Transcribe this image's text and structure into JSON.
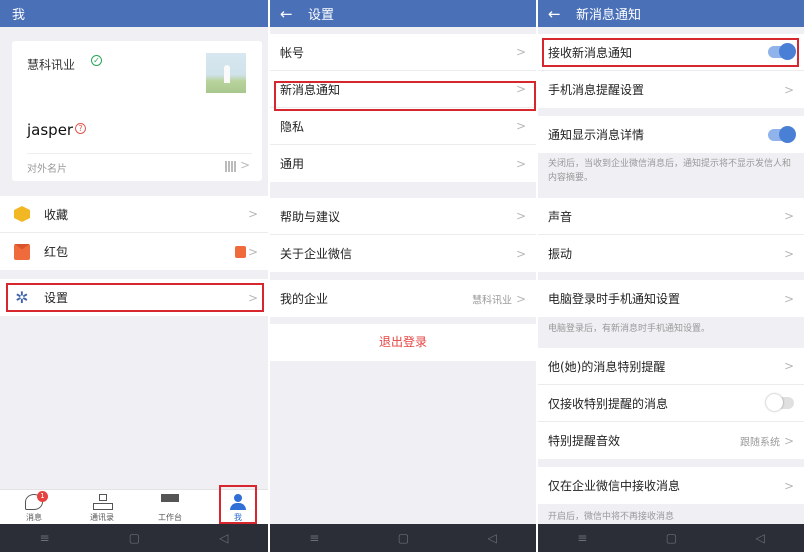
{
  "screen1": {
    "title": "我",
    "card": {
      "company": "慧科讯业",
      "verified_icon": "✓",
      "name": "jasper",
      "help_icon": "?",
      "namecard_label": "对外名片"
    },
    "menu": [
      {
        "label": "收藏",
        "icon": "cube-icon"
      },
      {
        "label": "红包",
        "icon": "red-envelope-icon"
      }
    ],
    "settings_label": "设置",
    "tabs": [
      {
        "label": "消息",
        "badge": "1"
      },
      {
        "label": "通讯录"
      },
      {
        "label": "工作台"
      },
      {
        "label": "我"
      }
    ]
  },
  "screen2": {
    "title": "设置",
    "group1": [
      "帐号",
      "新消息通知",
      "隐私",
      "通用"
    ],
    "group2": [
      "帮助与建议",
      "关于企业微信"
    ],
    "enterprise_label": "我的企业",
    "enterprise_value": "慧科讯业",
    "logout": "退出登录"
  },
  "screen3": {
    "title": "新消息通知",
    "receive_label": "接收新消息通知",
    "receive_on": true,
    "phone_reminder_label": "手机消息提醒设置",
    "show_detail_label": "通知显示消息详情",
    "show_detail_on": true,
    "show_detail_note": "关闭后，当收到企业微信消息后，通知提示将不显示发信人和内容摘要。",
    "sound_label": "声音",
    "vibrate_label": "振动",
    "pc_login_label": "电脑登录时手机通知设置",
    "pc_login_note": "电脑登录后，有新消息时手机通知设置。",
    "special_label": "他(她)的消息特别提醒",
    "only_special_label": "仅接收特别提醒的消息",
    "only_special_on": false,
    "special_sound_label": "特别提醒音效",
    "special_sound_value": "跟随系统",
    "only_wework_label": "仅在企业微信中接收消息",
    "only_wework_note": "开启后，微信中将不再接收消息"
  },
  "system_nav": {
    "menu": "≡",
    "home": "▢",
    "back": "◁"
  },
  "glyphs": {
    "back_arrow": "←",
    "chevron": ">",
    "gear": "✲"
  },
  "colors": {
    "topbar": "#4a71b8",
    "highlight": "#d8262e",
    "accent": "#4a7fd6",
    "danger": "#e64340"
  }
}
